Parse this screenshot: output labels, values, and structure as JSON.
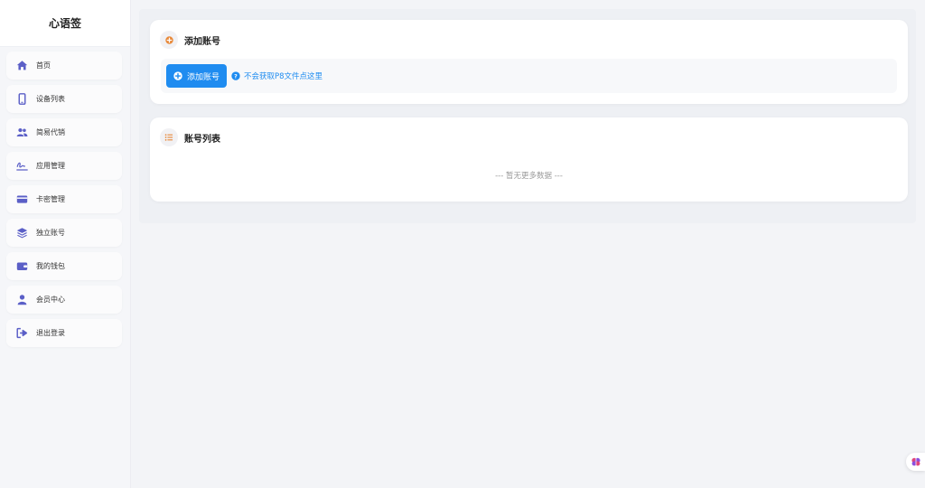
{
  "app": {
    "title": "心语签"
  },
  "sidebar": {
    "items": [
      {
        "label": "首页",
        "icon": "home-icon"
      },
      {
        "label": "设备列表",
        "icon": "phone-icon"
      },
      {
        "label": "简易代销",
        "icon": "users-icon"
      },
      {
        "label": "应用管理",
        "icon": "signature-icon"
      },
      {
        "label": "卡密管理",
        "icon": "credit-card-icon"
      },
      {
        "label": "独立账号",
        "icon": "layers-icon"
      },
      {
        "label": "我的钱包",
        "icon": "wallet-icon"
      },
      {
        "label": "会员中心",
        "icon": "user-icon"
      },
      {
        "label": "退出登录",
        "icon": "logout-icon"
      }
    ],
    "icon_color": "#5b5fc7"
  },
  "add_account": {
    "title": "添加账号",
    "button_label": "添加账号",
    "help_text": "不会获取P8文件点这里",
    "header_icon": "plus-circle-icon",
    "header_icon_color": "#e8893a"
  },
  "account_list": {
    "title": "账号列表",
    "empty_text": "--- 暂无更多数据 ---",
    "header_icon": "list-icon",
    "header_icon_color": "#e8893a"
  },
  "colors": {
    "primary": "#1f8cf0"
  }
}
